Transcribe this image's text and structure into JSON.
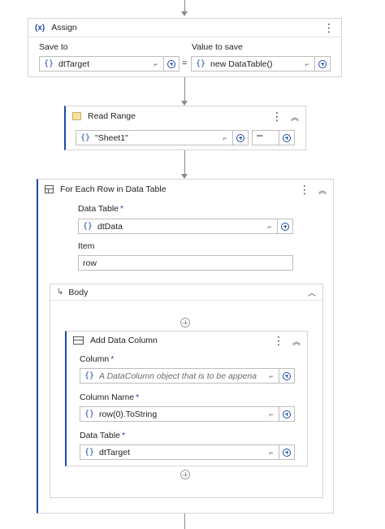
{
  "assign": {
    "icon": "variable-icon",
    "title": "Assign",
    "save_to_label": "Save to",
    "value_label": "Value to save",
    "save_to_value": "dtTarget",
    "equals": "=",
    "value": "new DataTable()"
  },
  "read_range": {
    "title": "Read Range",
    "sheet_value": "\"Sheet1\"",
    "range_value": "\"\""
  },
  "for_each": {
    "title": "For Each Row in Data Table",
    "data_table_label": "Data Table",
    "data_table_value": "dtData",
    "item_label": "Item",
    "item_value": "row",
    "body_title": "Body"
  },
  "add_data_column": {
    "title": "Add Data Column",
    "column_label": "Column",
    "column_placeholder": "A DataColumn object that is to be appena",
    "column_name_label": "Column Name",
    "column_name_value": "row(0).ToString",
    "data_table_label": "Data Table",
    "data_table_value": "dtTarget"
  },
  "common": {
    "brace": "{}",
    "required_mark": "*"
  },
  "colors": {
    "accent": "#1d4aa5",
    "border": "#d5d5d5",
    "connector": "#8a8a8a"
  }
}
